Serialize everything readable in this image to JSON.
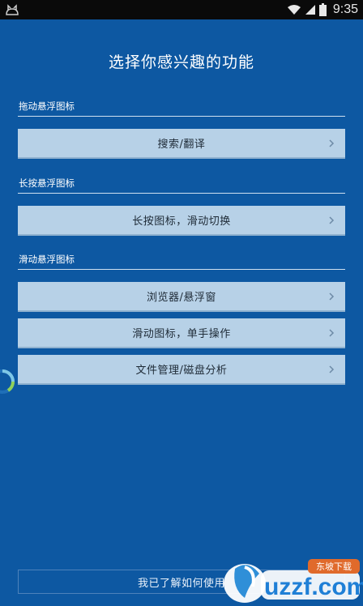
{
  "status_bar": {
    "time": "9:35",
    "icons": [
      "cat-icon",
      "wifi-icon",
      "signal-icon",
      "battery-icon"
    ]
  },
  "title": "选择你感兴趣的功能",
  "sections": [
    {
      "label": "拖动悬浮图标",
      "items": [
        "搜索/翻译"
      ]
    },
    {
      "label": "长按悬浮图标",
      "items": [
        "长按图标，滑动切换"
      ]
    },
    {
      "label": "滑动悬浮图标",
      "items": [
        "浏览器/悬浮窗",
        "滑动图标，单手操作",
        "文件管理/磁盘分析"
      ]
    }
  ],
  "bottom_button": "我已了解如何使用",
  "watermark": {
    "text": "uzzf.com",
    "badge": "东坡下载"
  },
  "colors": {
    "background": "#0d58a2",
    "item_bg": "#b7d1e7",
    "item_text": "#1e2a36",
    "status_bar": "#0a0a0a"
  }
}
